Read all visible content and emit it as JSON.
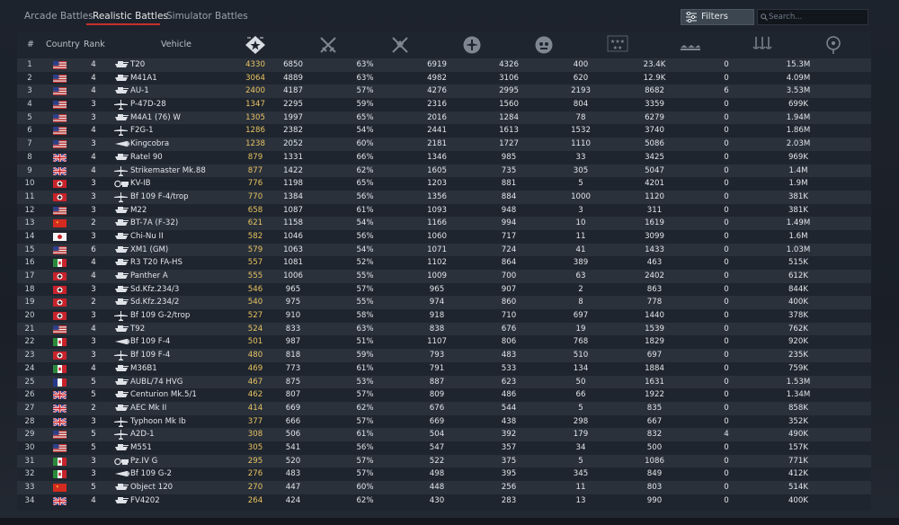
{
  "tabs": {
    "arcade": "Arcade Battles",
    "realistic": "Realistic Battles",
    "simulator": "Simulator Battles"
  },
  "toolbar": {
    "filters_label": "Filters",
    "search_placeholder": "Search..."
  },
  "headers": {
    "num": "#",
    "country": "Country",
    "rank": "Rank",
    "vehicle": "Vehicle"
  },
  "stat_icons": [
    "battle-rating-icon",
    "battles-icon",
    "win-rate-icon",
    "air-kills-icon",
    "ground-kills-icon",
    "frags-icon",
    "kills-per-battle-icon",
    "naval-kills-icon",
    "respawns-icon"
  ],
  "colors": {
    "accent": "#c9302c",
    "battle_rating": "#e8c462",
    "row_odd": "#2a313b",
    "row_even": "#1f252e"
  },
  "rows": [
    {
      "n": "1",
      "country": "usa",
      "rank": "4",
      "type": "tank",
      "name": "T20",
      "br": "4330",
      "v": [
        "6850",
        "63%",
        "6919",
        "4326",
        "400",
        "23.4K",
        "0",
        "15.3M"
      ]
    },
    {
      "n": "2",
      "country": "usa",
      "rank": "4",
      "type": "tank",
      "name": "M41A1",
      "br": "3064",
      "v": [
        "4889",
        "63%",
        "4982",
        "3106",
        "620",
        "12.9K",
        "0",
        "4.09M"
      ]
    },
    {
      "n": "3",
      "country": "usa",
      "rank": "4",
      "type": "tank",
      "name": "AU-1",
      "br": "2400",
      "v": [
        "4187",
        "57%",
        "4276",
        "2995",
        "2193",
        "8682",
        "6",
        "3.53M"
      ]
    },
    {
      "n": "4",
      "country": "usa",
      "rank": "3",
      "type": "plane",
      "name": "P-47D-28",
      "br": "1347",
      "v": [
        "2295",
        "59%",
        "2316",
        "1560",
        "804",
        "3359",
        "0",
        "699K"
      ]
    },
    {
      "n": "5",
      "country": "usa",
      "rank": "3",
      "type": "tank",
      "name": "M4A1 (76) W",
      "br": "1305",
      "v": [
        "1997",
        "65%",
        "2016",
        "1284",
        "78",
        "6279",
        "0",
        "1.94M"
      ]
    },
    {
      "n": "6",
      "country": "usa",
      "rank": "4",
      "type": "plane",
      "name": "F2G-1",
      "br": "1286",
      "v": [
        "2382",
        "54%",
        "2441",
        "1613",
        "1532",
        "3740",
        "0",
        "1.86M"
      ]
    },
    {
      "n": "7",
      "country": "usa",
      "rank": "3",
      "type": "plane-special",
      "name": "Kingcobra",
      "br": "1238",
      "v": [
        "2052",
        "60%",
        "2181",
        "1727",
        "1110",
        "5086",
        "0",
        "2.03M"
      ]
    },
    {
      "n": "8",
      "country": "uk",
      "rank": "4",
      "type": "tank",
      "name": "Ratel 90",
      "br": "879",
      "v": [
        "1331",
        "66%",
        "1346",
        "985",
        "33",
        "3425",
        "0",
        "969K"
      ]
    },
    {
      "n": "9",
      "country": "uk",
      "rank": "4",
      "type": "plane",
      "name": "Strikemaster Mk.88",
      "br": "877",
      "v": [
        "1422",
        "62%",
        "1605",
        "735",
        "305",
        "5047",
        "0",
        "1.4M"
      ]
    },
    {
      "n": "10",
      "country": "germany",
      "rank": "3",
      "type": "tank-special",
      "name": "KV-IB",
      "br": "776",
      "v": [
        "1198",
        "65%",
        "1203",
        "881",
        "5",
        "4201",
        "0",
        "1.9M"
      ]
    },
    {
      "n": "11",
      "country": "germany",
      "rank": "3",
      "type": "plane",
      "name": "Bf 109 F-4/trop",
      "br": "770",
      "v": [
        "1384",
        "56%",
        "1356",
        "884",
        "1000",
        "1120",
        "0",
        "381K"
      ]
    },
    {
      "n": "12",
      "country": "usa",
      "rank": "3",
      "type": "tank",
      "name": "M22",
      "br": "658",
      "v": [
        "1087",
        "61%",
        "1093",
        "948",
        "3",
        "311",
        "0",
        "381K"
      ]
    },
    {
      "n": "13",
      "country": "china",
      "rank": "2",
      "type": "tank",
      "name": "BT-7A (F-32)",
      "br": "621",
      "v": [
        "1158",
        "54%",
        "1166",
        "994",
        "10",
        "1619",
        "0",
        "1.49M"
      ]
    },
    {
      "n": "14",
      "country": "japan",
      "rank": "3",
      "type": "tank",
      "name": "Chi-Nu II",
      "br": "582",
      "v": [
        "1046",
        "56%",
        "1060",
        "717",
        "11",
        "3099",
        "0",
        "1.6M"
      ]
    },
    {
      "n": "15",
      "country": "usa",
      "rank": "6",
      "type": "tank",
      "name": "XM1 (GM)",
      "br": "579",
      "v": [
        "1063",
        "54%",
        "1071",
        "724",
        "41",
        "1433",
        "0",
        "1.03M"
      ]
    },
    {
      "n": "16",
      "country": "italy",
      "rank": "4",
      "type": "tank",
      "name": "R3 T20 FA-HS",
      "br": "557",
      "v": [
        "1081",
        "52%",
        "1102",
        "864",
        "389",
        "463",
        "0",
        "515K"
      ]
    },
    {
      "n": "17",
      "country": "germany",
      "rank": "4",
      "type": "tank",
      "name": "Panther A",
      "br": "555",
      "v": [
        "1006",
        "55%",
        "1009",
        "700",
        "63",
        "2402",
        "0",
        "612K"
      ]
    },
    {
      "n": "18",
      "country": "germany",
      "rank": "3",
      "type": "tank",
      "name": "Sd.Kfz.234/3",
      "br": "546",
      "v": [
        "965",
        "57%",
        "965",
        "907",
        "2",
        "863",
        "0",
        "844K"
      ]
    },
    {
      "n": "19",
      "country": "germany",
      "rank": "2",
      "type": "tank",
      "name": "Sd.Kfz.234/2",
      "br": "540",
      "v": [
        "975",
        "55%",
        "974",
        "860",
        "8",
        "778",
        "0",
        "400K"
      ]
    },
    {
      "n": "20",
      "country": "germany",
      "rank": "3",
      "type": "plane",
      "name": "Bf 109 G-2/trop",
      "br": "527",
      "v": [
        "910",
        "58%",
        "918",
        "710",
        "697",
        "1440",
        "0",
        "378K"
      ]
    },
    {
      "n": "21",
      "country": "usa",
      "rank": "4",
      "type": "tank",
      "name": "T92",
      "br": "524",
      "v": [
        "833",
        "63%",
        "838",
        "676",
        "19",
        "1539",
        "0",
        "762K"
      ]
    },
    {
      "n": "22",
      "country": "italy",
      "rank": "3",
      "type": "plane-special",
      "name": "Bf 109 F-4",
      "br": "501",
      "v": [
        "987",
        "51%",
        "1107",
        "806",
        "768",
        "1829",
        "0",
        "920K"
      ]
    },
    {
      "n": "23",
      "country": "germany",
      "rank": "3",
      "type": "plane",
      "name": "Bf 109 F-4",
      "br": "480",
      "v": [
        "818",
        "59%",
        "793",
        "483",
        "510",
        "697",
        "0",
        "235K"
      ]
    },
    {
      "n": "24",
      "country": "italy",
      "rank": "4",
      "type": "tank",
      "name": "M36B1",
      "br": "469",
      "v": [
        "773",
        "61%",
        "791",
        "533",
        "134",
        "1884",
        "0",
        "759K"
      ]
    },
    {
      "n": "25",
      "country": "france",
      "rank": "5",
      "type": "tank",
      "name": "AUBL/74 HVG",
      "br": "467",
      "v": [
        "875",
        "53%",
        "887",
        "623",
        "50",
        "1631",
        "0",
        "1.53M"
      ]
    },
    {
      "n": "26",
      "country": "uk",
      "rank": "5",
      "type": "tank",
      "name": "Centurion Mk.5/1",
      "br": "462",
      "v": [
        "807",
        "57%",
        "809",
        "486",
        "66",
        "1922",
        "0",
        "1.34M"
      ]
    },
    {
      "n": "27",
      "country": "uk",
      "rank": "2",
      "type": "tank",
      "name": "AEC Mk II",
      "br": "414",
      "v": [
        "669",
        "62%",
        "676",
        "544",
        "5",
        "835",
        "0",
        "858K"
      ]
    },
    {
      "n": "28",
      "country": "uk",
      "rank": "3",
      "type": "plane",
      "name": "Typhoon Mk Ib",
      "br": "377",
      "v": [
        "666",
        "57%",
        "669",
        "438",
        "298",
        "667",
        "0",
        "352K"
      ]
    },
    {
      "n": "29",
      "country": "usa",
      "rank": "5",
      "type": "plane",
      "name": "A2D-1",
      "br": "308",
      "v": [
        "506",
        "61%",
        "504",
        "392",
        "179",
        "832",
        "4",
        "490K"
      ]
    },
    {
      "n": "30",
      "country": "usa",
      "rank": "5",
      "type": "tank",
      "name": "M551",
      "br": "305",
      "v": [
        "541",
        "56%",
        "547",
        "357",
        "34",
        "500",
        "0",
        "157K"
      ]
    },
    {
      "n": "31",
      "country": "italy",
      "rank": "3",
      "type": "tank-special",
      "name": "Pz.IV G",
      "br": "295",
      "v": [
        "520",
        "57%",
        "522",
        "375",
        "5",
        "1086",
        "0",
        "771K"
      ]
    },
    {
      "n": "32",
      "country": "italy",
      "rank": "3",
      "type": "plane-special",
      "name": "Bf 109 G-2",
      "br": "276",
      "v": [
        "483",
        "57%",
        "498",
        "395",
        "345",
        "849",
        "0",
        "412K"
      ]
    },
    {
      "n": "33",
      "country": "china",
      "rank": "5",
      "type": "tank",
      "name": "Object 120",
      "br": "270",
      "v": [
        "447",
        "60%",
        "448",
        "256",
        "11",
        "803",
        "0",
        "514K"
      ]
    },
    {
      "n": "34",
      "country": "uk",
      "rank": "4",
      "type": "tank",
      "name": "FV4202",
      "br": "264",
      "v": [
        "424",
        "62%",
        "430",
        "283",
        "13",
        "990",
        "0",
        "400K"
      ]
    }
  ]
}
